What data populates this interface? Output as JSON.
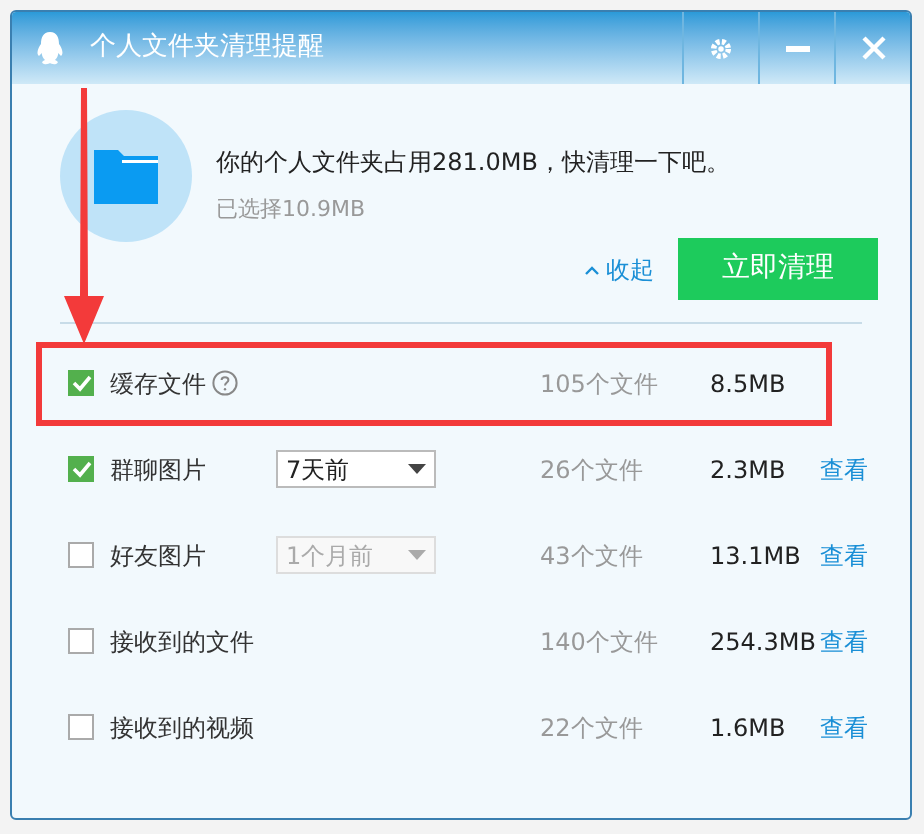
{
  "window": {
    "title": "个人文件夹清理提醒"
  },
  "summary": {
    "message": "你的个人文件夹占用281.0MB，快清理一下吧。",
    "selected": "已选择10.9MB",
    "collapse": "收起",
    "clean_button": "立即清理"
  },
  "rows": [
    {
      "label": "缓存文件",
      "checked": true,
      "help": true,
      "count": "105个文件",
      "size": "8.5MB",
      "highlighted": true
    },
    {
      "label": "群聊图片",
      "checked": true,
      "dropdown": {
        "value": "7天前",
        "disabled": false
      },
      "count": "26个文件",
      "size": "2.3MB",
      "link": "查看"
    },
    {
      "label": "好友图片",
      "checked": false,
      "dropdown": {
        "value": "1个月前",
        "disabled": true
      },
      "count": "43个文件",
      "size": "13.1MB",
      "link": "查看"
    },
    {
      "label": "接收到的文件",
      "checked": false,
      "count": "140个文件",
      "size": "254.3MB",
      "link": "查看"
    },
    {
      "label": "接收到的视频",
      "checked": false,
      "count": "22个文件",
      "size": "1.6MB",
      "link": "查看"
    }
  ]
}
